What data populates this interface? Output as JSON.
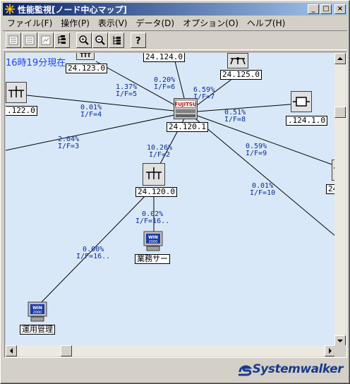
{
  "window": {
    "title": "性能監視[ノード中心マップ]",
    "controls": {
      "minimize": "_",
      "maximize": "□",
      "close": "×"
    }
  },
  "menu": [
    "ファイル(F)",
    "操作(P)",
    "表示(V)",
    "データ(D)",
    "オプション(O)",
    "ヘルプ(H)"
  ],
  "toolbar": {
    "tools": [
      "view-list-1",
      "view-list-2",
      "view-list-3",
      "tree-view",
      "zoom-in",
      "zoom-out",
      "hierarchy",
      "help"
    ]
  },
  "map": {
    "timestamp": "16時19分現在",
    "nodes": {
      "center": "24.120.1",
      "n123": "24.123.0",
      "n124": "24.124.0",
      "n125": "24.125.0",
      "n122": ".122.0",
      "n1241": ".124.1.0",
      "n120": "24.120.0",
      "right_edge": "24.",
      "server": "業務サー",
      "admin": "運用管理"
    },
    "links": [
      {
        "id": "if6",
        "pct": "0.20%",
        "ifname": "I/F=6"
      },
      {
        "id": "if5",
        "pct": "1.37%",
        "ifname": "I/F=5"
      },
      {
        "id": "if7",
        "pct": "6.59%",
        "ifname": "I/F=7"
      },
      {
        "id": "if4",
        "pct": "0.01%",
        "ifname": "I/F=4"
      },
      {
        "id": "if8",
        "pct": "0.51%",
        "ifname": "I/F=8"
      },
      {
        "id": "if3",
        "pct": "2.04%",
        "ifname": "I/F=3"
      },
      {
        "id": "if2",
        "pct": "10.26%",
        "ifname": "I/F=2"
      },
      {
        "id": "if9",
        "pct": "0.59%",
        "ifname": "I/F=9"
      },
      {
        "id": "if10",
        "pct": "0.01%",
        "ifname": "I/F=10"
      },
      {
        "id": "if16a",
        "pct": "0.02%",
        "ifname": "I/F=16.."
      },
      {
        "id": "if16b",
        "pct": "0.00%",
        "ifname": "I/F=16.."
      }
    ],
    "center_brand": "FUJITSU",
    "win_badge": "WIN 2000"
  },
  "brand": "Systemwalker",
  "colors": {
    "title_start": "#0a246a",
    "title_end": "#a6caf0",
    "map_bg": "#d8e8f8",
    "link_text": "#0a2aa0",
    "timestamp": "#1f3fff",
    "brand": "#1a3a8a"
  }
}
